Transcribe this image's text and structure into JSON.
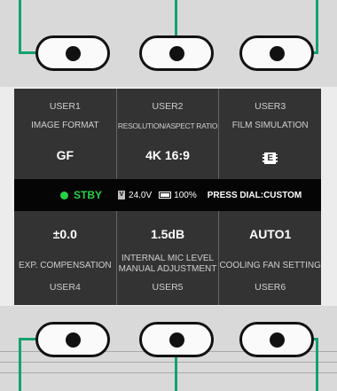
{
  "top_row": [
    {
      "user": "USER1",
      "label": "IMAGE FORMAT",
      "value": "GF"
    },
    {
      "user": "USER2",
      "label": "RESOLUTION/ASPECT RATIO",
      "value": "4K 16:9"
    },
    {
      "user": "USER3",
      "label": "FILM SIMULATION",
      "value_icon": "film-simulation-icon",
      "icon_text": "E"
    }
  ],
  "status_bar": {
    "state": "STBY",
    "voltage_badge": "V",
    "voltage": "24.0V",
    "battery_icon": "battery-icon",
    "battery": "100%",
    "hint": "PRESS DIAL:CUSTOM",
    "state_color": "#27d146"
  },
  "bottom_row": [
    {
      "value": "±0.0",
      "label": "EXP. COMPENSATION",
      "user": "USER4"
    },
    {
      "value": "1.5dB",
      "label_line1": "INTERNAL MIC LEVEL",
      "label_line2": "MANUAL ADJUSTMENT",
      "user": "USER5"
    },
    {
      "value": "AUTO1",
      "label": "COOLING FAN SETTING",
      "user": "USER6"
    }
  ],
  "colors": {
    "leader": "#13a26e",
    "panel": "#333333",
    "status_bg": "#050505"
  }
}
